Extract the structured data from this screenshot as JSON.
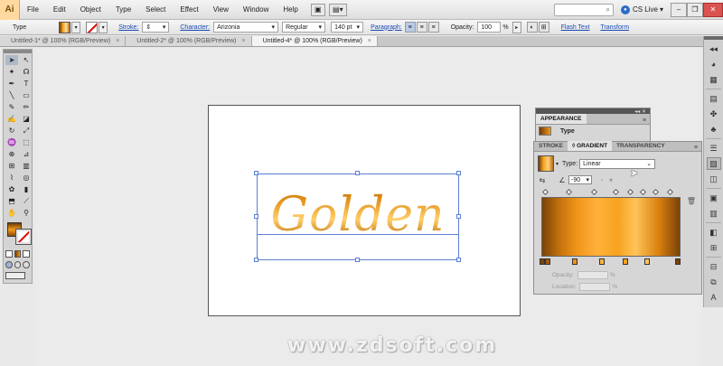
{
  "menubar": {
    "app_logo": "Ai",
    "items": [
      "File",
      "Edit",
      "Object",
      "Type",
      "Select",
      "Effect",
      "View",
      "Window",
      "Help"
    ],
    "cs_live": "CS Live",
    "cs_live_arrow": "▾",
    "search_icon": "⌕"
  },
  "controlbar": {
    "tool_label": "Type",
    "stroke_label": "Stroke:",
    "character_label": "Character:",
    "font_family": "Arizonia",
    "font_style": "Regular",
    "font_size": "140 pt",
    "paragraph_label": "Paragraph:",
    "opacity_label": "Opacity:",
    "opacity_value": "100",
    "opacity_unit": "%",
    "flash_text": "Flash Text",
    "transform": "Transform"
  },
  "tabs": [
    {
      "label": "Untitled-1* @ 100% (RGB/Preview)",
      "close": "×"
    },
    {
      "label": "Untitled-2* @ 100% (RGB/Preview)",
      "close": "×"
    },
    {
      "label": "Untitled-4* @ 100% (RGB/Preview)",
      "close": "×"
    }
  ],
  "canvas": {
    "text": "Golden"
  },
  "appearance_panel": {
    "tab": "APPEARANCE",
    "row_label": "Type",
    "menu_icon": "≡"
  },
  "gradient_panel": {
    "tabs": [
      "STROKE",
      "◊ GRADIENT",
      "TRANSPARENCY"
    ],
    "type_label": "Type:",
    "type_value": "Linear",
    "angle_value": "-90",
    "opacity_label": "Opacity:",
    "location_label": "Location:",
    "percent": "%",
    "menu_icon": "≡"
  },
  "watermark": "www.zdsoft.com",
  "colors": {
    "gold_dark": "#6e3a05",
    "gold_mid": "#f39a1c",
    "gold_light": "#ffd27a",
    "selection": "#5a7fd4"
  }
}
